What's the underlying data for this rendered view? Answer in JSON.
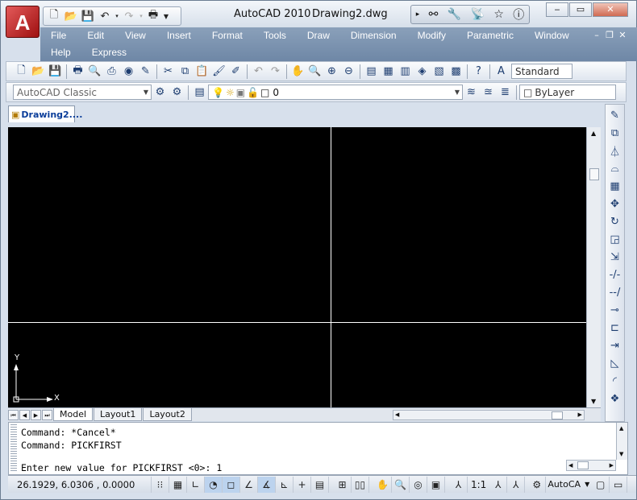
{
  "app": {
    "logo_letter": "A",
    "product": "AutoCAD 2010",
    "document": "Drawing2.dwg"
  },
  "quick_access": [
    "new-icon",
    "open-icon",
    "save-icon",
    "undo-icon",
    "redo-icon",
    "plot-icon"
  ],
  "window_controls": {
    "minimize": "‒",
    "restore": "▭",
    "close": "✕"
  },
  "menu": {
    "row1": [
      "File",
      "Edit",
      "View",
      "Insert",
      "Format",
      "Tools",
      "Draw",
      "Dimension",
      "Modify",
      "Parametric",
      "Window"
    ],
    "row2": [
      "Help",
      "Express"
    ]
  },
  "toolbar_standard": {
    "text_style": "Standard"
  },
  "workspace": {
    "value": "AutoCAD Classic"
  },
  "layer": {
    "value": "0"
  },
  "color": {
    "value": "ByLayer"
  },
  "doc_tab": {
    "label": "Drawing2...."
  },
  "layout_tabs": [
    "Model",
    "Layout1",
    "Layout2"
  ],
  "ucs": {
    "x": "X",
    "y": "Y"
  },
  "command": {
    "history": [
      "Command: *Cancel*",
      "Command: PICKFIRST"
    ],
    "prompt": "Enter new value for PICKFIRST <0>: 1"
  },
  "status": {
    "coords": "26.1929, 6.0306 , 0.0000",
    "scale": "1:1",
    "workspace_short": "AutoCA"
  },
  "colors": {
    "canvas": "#000000",
    "menubar": "#7a92b0"
  }
}
